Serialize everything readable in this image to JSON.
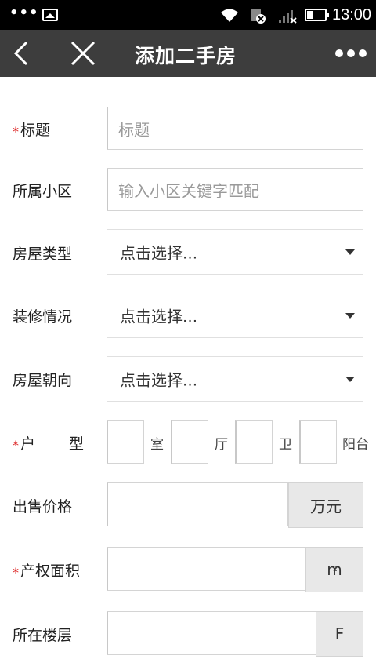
{
  "status_bar": {
    "dots": "•••",
    "time": "13:00",
    "icons": [
      "image-icon",
      "wifi-icon",
      "sim-icon",
      "signal-icon",
      "battery-icon"
    ]
  },
  "nav": {
    "title": "添加二手房",
    "back_icon": "chevron-left-icon",
    "close_icon": "close-icon",
    "more_icon": "more-horizontal-icon"
  },
  "form": {
    "required_mark": "*",
    "title": {
      "label": "标题",
      "placeholder": "标题",
      "value": ""
    },
    "community": {
      "label": "所属小区",
      "placeholder": "输入小区关键字匹配",
      "value": ""
    },
    "house_type": {
      "label": "房屋类型",
      "selected": "点击选择..."
    },
    "decoration": {
      "label": "装修情况",
      "selected": "点击选择..."
    },
    "orientation": {
      "label": "房屋朝向",
      "selected": "点击选择..."
    },
    "layout": {
      "label_a": "户",
      "label_b": "型",
      "room_unit": "室",
      "hall_unit": "厅",
      "bath_unit": "卫",
      "balcony_unit": "阳台"
    },
    "price": {
      "label": "出售价格",
      "unit": "万元",
      "value": ""
    },
    "area": {
      "label": "产权面积",
      "unit": "m",
      "unit_sup": "2",
      "value": ""
    },
    "floor": {
      "label": "所在楼层",
      "unit": "F",
      "value": ""
    }
  },
  "colors": {
    "status_bar_bg": "#000000",
    "nav_bg": "#3d3d3d",
    "required": "#dd2222",
    "addon_bg": "#e8e8e8"
  }
}
